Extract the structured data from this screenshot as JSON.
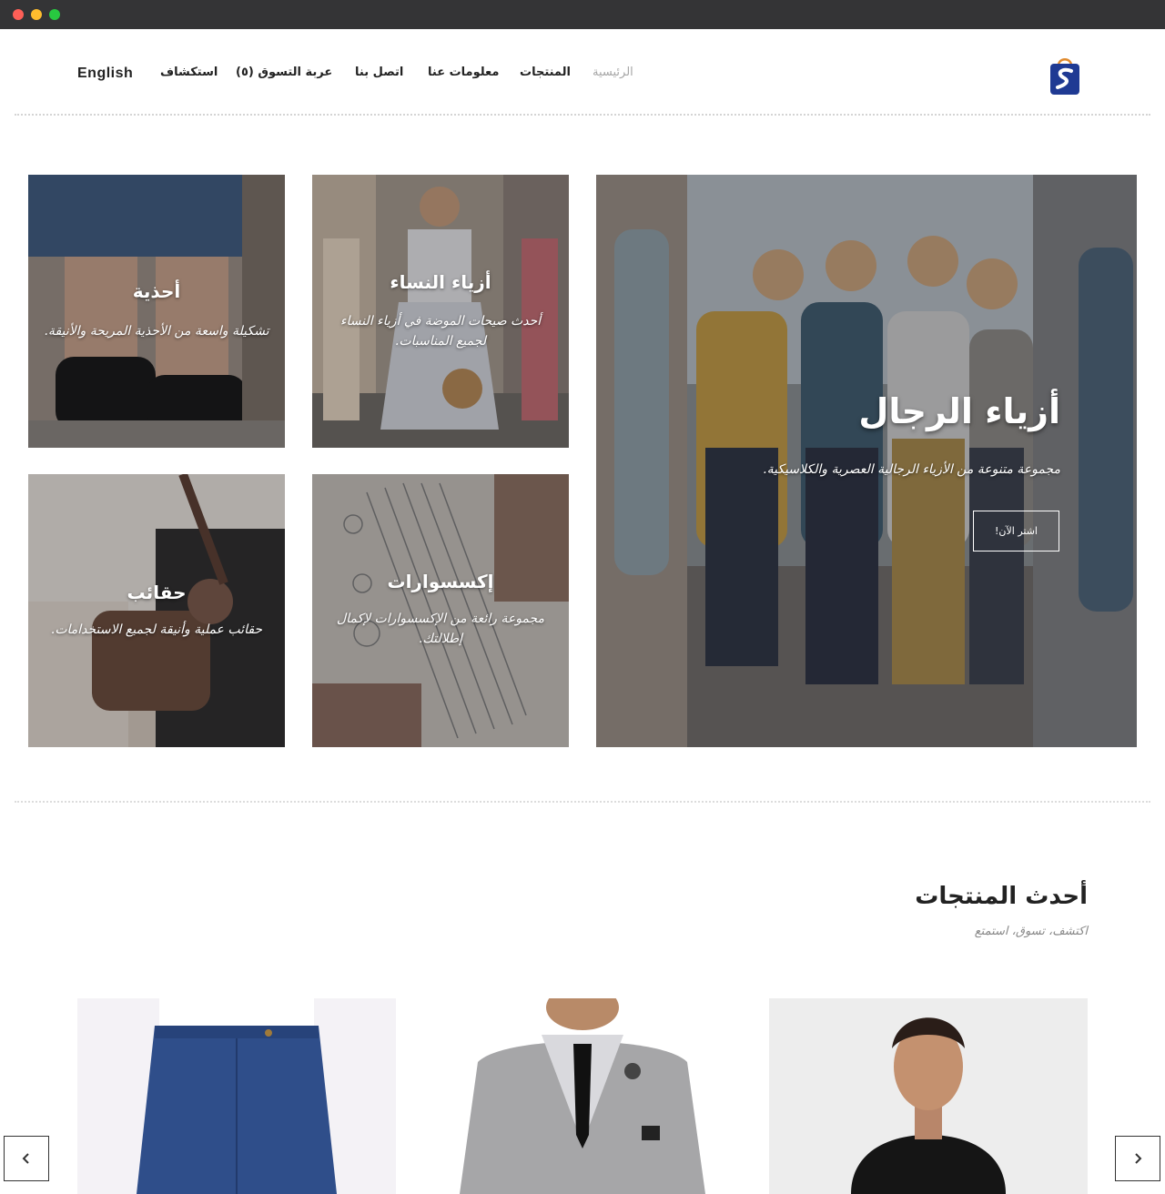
{
  "header": {
    "logo_name": "shopping-bag-logo",
    "nav": {
      "home": "الرئيسية",
      "products": "المنتجات",
      "about": "معلومات عنا",
      "contact": "اتصل بنا",
      "cart": "عربة التسوق (٥)",
      "explore": "استكشاف"
    },
    "language": "English"
  },
  "categories": {
    "men": {
      "title": "أزياء الرجال",
      "desc": "مجموعة متنوعة من الأزياء الرجالية العصرية والكلاسيكية.",
      "button": "اشتر الآن!"
    },
    "women": {
      "title": "أزياء النساء",
      "desc": "أحدث صيحات الموضة في أزياء النساء لجميع المناسبات."
    },
    "shoes": {
      "title": "أحذية",
      "desc": "تشكيلة واسعة من الأحذية المريحة والأنيقة."
    },
    "accessories": {
      "title": "إكسسوارات",
      "desc": "مجموعة رائعة من الإكسسوارات لإكمال إطلالتك."
    },
    "bags": {
      "title": "حقائب",
      "desc": "حقائب عملية وأنيقة لجميع الاستخدامات."
    }
  },
  "latest": {
    "title": "أحدث المنتجات",
    "subtitle": "اكتشف، تسوق، استمتع"
  },
  "colors": {
    "accent_blue": "#1f3a93",
    "accent_orange": "#e08a2e",
    "nav_active": "#a6a6a6"
  },
  "icons": {
    "prev": "chevron-left-icon",
    "next": "chevron-right-icon"
  }
}
